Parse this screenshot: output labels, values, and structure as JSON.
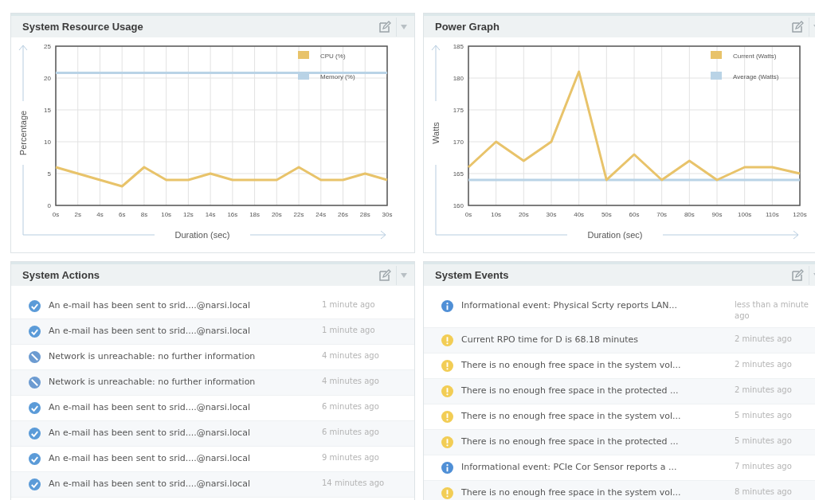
{
  "panels": [
    {
      "title": "System Resource Usage",
      "chart_data": {
        "type": "line",
        "grid": true,
        "legend": "top-right",
        "xlabel": "Duration (sec)",
        "ylabel": "Percentage",
        "categories": [
          "0s",
          "2s",
          "4s",
          "6s",
          "8s",
          "10s",
          "12s",
          "14s",
          "16s",
          "18s",
          "20s",
          "22s",
          "24s",
          "26s",
          "28s",
          "30s"
        ],
        "ylim": [
          0,
          25
        ],
        "yticks": [
          0,
          5,
          10,
          15,
          20,
          25
        ],
        "series": [
          {
            "name": "CPU (%)",
            "color": "#e8c36a",
            "values": [
              6,
              5,
              4,
              3,
              6,
              4,
              4,
              5,
              4,
              4,
              4,
              6,
              4,
              4,
              5,
              4
            ]
          },
          {
            "name": "Memory (%)",
            "color": "#b9d3e6",
            "values": [
              20.8,
              20.8,
              20.8,
              20.8,
              20.8,
              20.8,
              20.8,
              20.8,
              20.8,
              20.8,
              20.8,
              20.8,
              20.8,
              20.8,
              20.8,
              20.8
            ]
          }
        ]
      }
    },
    {
      "title": "Power Graph",
      "chart_data": {
        "type": "line",
        "grid": true,
        "legend": "top-right",
        "xlabel": "Duration (sec)",
        "ylabel": "Watts",
        "categories": [
          "0s",
          "10s",
          "20s",
          "30s",
          "40s",
          "50s",
          "60s",
          "70s",
          "80s",
          "90s",
          "100s",
          "110s",
          "120s"
        ],
        "ylim": [
          160,
          185
        ],
        "yticks": [
          160,
          165,
          170,
          175,
          180,
          185
        ],
        "series": [
          {
            "name": "Current (Watts)",
            "color": "#e8c36a",
            "values": [
              166,
              170,
              167,
              170,
              181,
              164,
              168,
              164,
              167,
              164,
              166,
              166,
              165
            ]
          },
          {
            "name": "Average (Watts)",
            "color": "#b9d3e6",
            "values": [
              164,
              164,
              164,
              164,
              164,
              164,
              164,
              164,
              164,
              164,
              164,
              164,
              164
            ]
          }
        ]
      }
    },
    {
      "title": "System Actions",
      "items": [
        {
          "kind": "success",
          "text": "An e-mail has been sent to srid....@narsi.local",
          "time": "1 minute ago"
        },
        {
          "kind": "success",
          "text": "An e-mail has been sent to srid....@narsi.local",
          "time": "1 minute ago"
        },
        {
          "kind": "blocked",
          "text": "Network is unreachable: no further information",
          "time": "4 minutes ago"
        },
        {
          "kind": "blocked",
          "text": "Network is unreachable: no further information",
          "time": "4 minutes ago"
        },
        {
          "kind": "success",
          "text": "An e-mail has been sent to srid....@narsi.local",
          "time": "6 minutes ago"
        },
        {
          "kind": "success",
          "text": "An e-mail has been sent to srid....@narsi.local",
          "time": "6 minutes ago"
        },
        {
          "kind": "success",
          "text": "An e-mail has been sent to srid....@narsi.local",
          "time": "9 minutes ago"
        },
        {
          "kind": "success",
          "text": "An e-mail has been sent to srid....@narsi.local",
          "time": "14 minutes ago"
        }
      ]
    },
    {
      "title": "System Events",
      "items": [
        {
          "kind": "info",
          "text": "Informational event: Physical Scrty reports LAN...",
          "time": "less than a minute ago"
        },
        {
          "kind": "warning",
          "text": "Current RPO time for D is 68.18 minutes",
          "time": "2 minutes ago"
        },
        {
          "kind": "warning",
          "text": "There is no enough free space in the system vol...",
          "time": "2 minutes ago"
        },
        {
          "kind": "warning",
          "text": "There is no enough free space in the protected ...",
          "time": "2 minutes ago"
        },
        {
          "kind": "warning",
          "text": "There is no enough free space in the system vol...",
          "time": "5 minutes ago"
        },
        {
          "kind": "warning",
          "text": "There is no enough free space in the protected ...",
          "time": "5 minutes ago"
        },
        {
          "kind": "info",
          "text": "Informational event: PCIe Cor Sensor reports a ...",
          "time": "7 minutes ago"
        },
        {
          "kind": "warning",
          "text": "There is no enough free space in the system vol...",
          "time": "8 minutes ago"
        }
      ]
    }
  ]
}
